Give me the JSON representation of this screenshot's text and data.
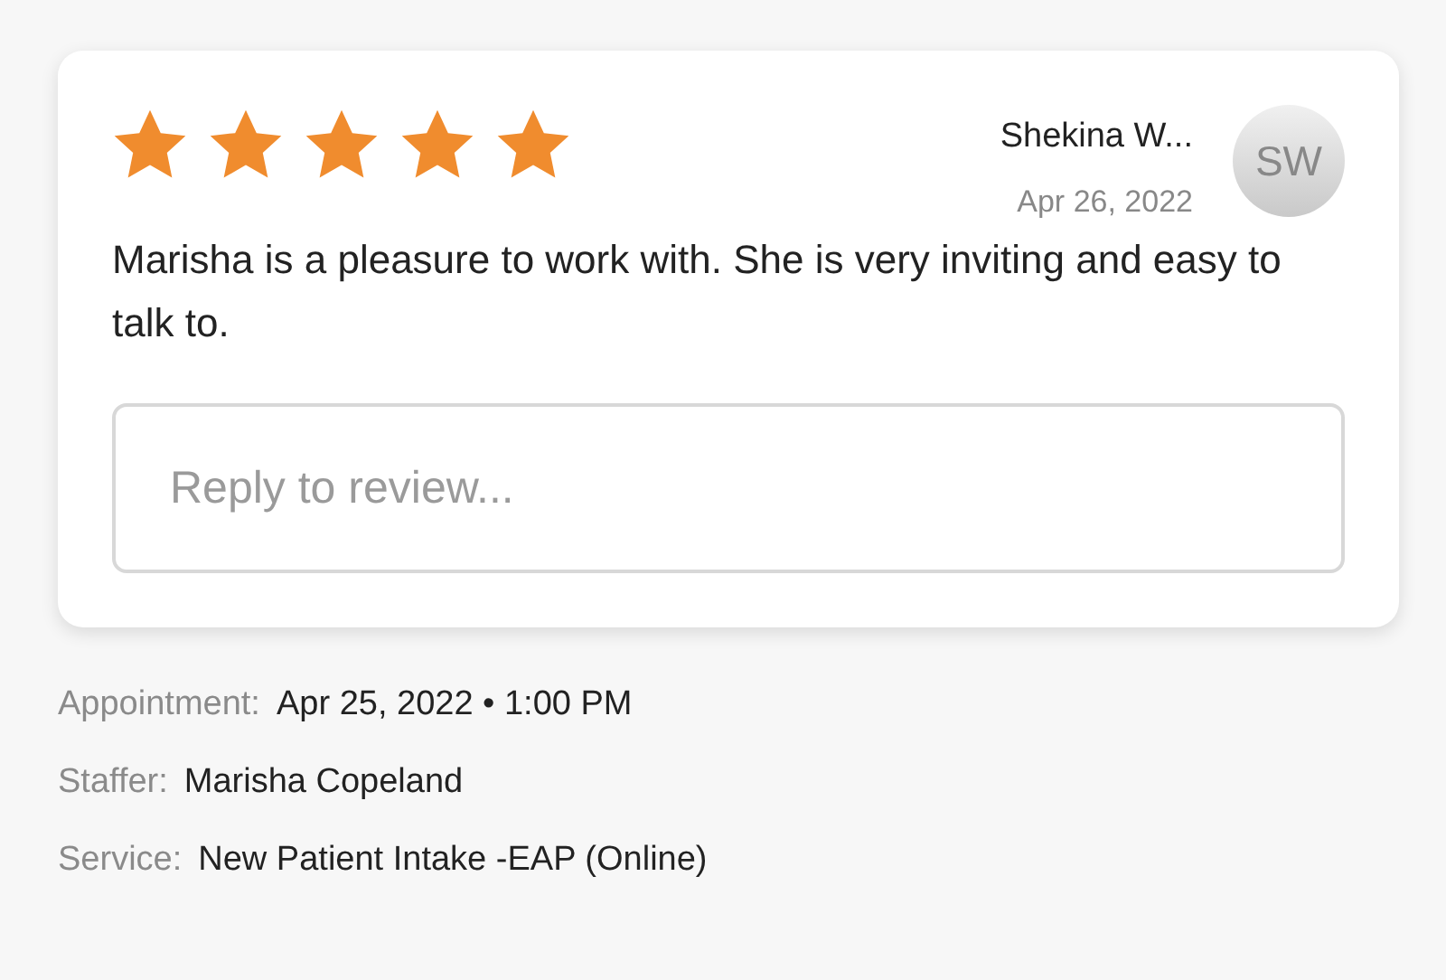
{
  "review": {
    "stars": 5,
    "reviewer": "Shekina W...",
    "date": "Apr 26, 2022",
    "avatar_initials": "SW",
    "text": "Marisha is a pleasure to work with. She is very inviting and easy to talk to.",
    "reply": {
      "placeholder": "Reply to review..."
    }
  },
  "details": [
    {
      "label": "Appointment:",
      "value": "Apr 25, 2022 • 1:00 PM"
    },
    {
      "label": "Staffer:",
      "value": "Marisha Copeland"
    },
    {
      "label": "Service:",
      "value": "New Patient Intake -EAP (Online)"
    }
  ]
}
